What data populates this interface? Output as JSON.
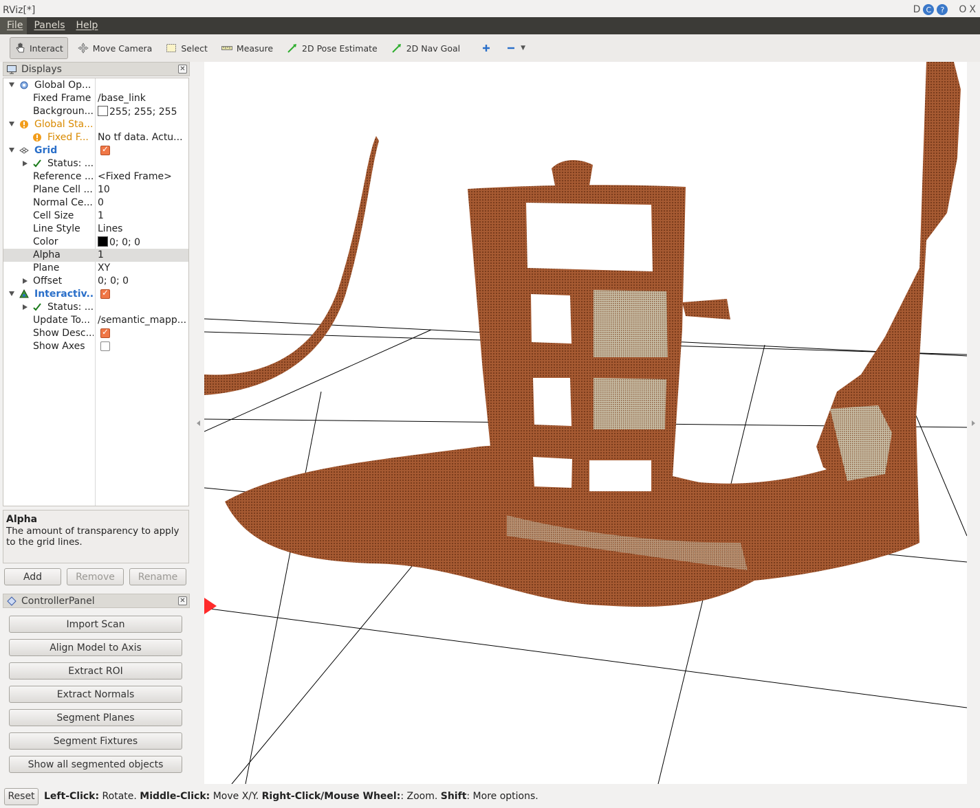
{
  "window": {
    "title": "RViz[*]",
    "controls": [
      "D",
      "C",
      "?",
      "O",
      "X"
    ]
  },
  "menu": [
    "File",
    "Panels",
    "Help"
  ],
  "toolbar": {
    "tools": [
      {
        "label": "Interact",
        "icon": "hand-pointer-icon",
        "active": true
      },
      {
        "label": "Move Camera",
        "icon": "move-arrows-icon"
      },
      {
        "label": "Select",
        "icon": "select-rect-icon"
      },
      {
        "label": "Measure",
        "icon": "ruler-icon"
      },
      {
        "label": "2D Pose Estimate",
        "icon": "green-arrow-icon"
      },
      {
        "label": "2D Nav Goal",
        "icon": "green-arrow-icon"
      }
    ],
    "add_icon": "plus-icon",
    "remove_icon": "minus-icon"
  },
  "displays": {
    "title": "Displays",
    "rows": [
      {
        "indent": 0,
        "expand": "down",
        "icon": "gear-icon",
        "label": "Global Op...",
        "value": ""
      },
      {
        "indent": 1,
        "label": "Fixed Frame",
        "value": "/base_link"
      },
      {
        "indent": 1,
        "label": "Backgroun...",
        "value": "255; 255; 255",
        "swatch": "#ffffff"
      },
      {
        "indent": 0,
        "expand": "down",
        "icon": "warning-icon",
        "label": "Global Sta...",
        "value": "",
        "style": "warn"
      },
      {
        "indent": 1,
        "icon": "warning-icon",
        "label": "Fixed F...",
        "value": "No tf data.  Actu...",
        "style": "warn"
      },
      {
        "indent": 0,
        "expand": "down",
        "icon": "grid-icon",
        "label": "Grid",
        "value": "",
        "style": "blue",
        "check": true
      },
      {
        "indent": 1,
        "expand": "right",
        "icon": "ok-check-icon",
        "label": "Status: ...",
        "value": ""
      },
      {
        "indent": 1,
        "label": "Reference ...",
        "value": "<Fixed Frame>"
      },
      {
        "indent": 1,
        "label": "Plane Cell ...",
        "value": "10"
      },
      {
        "indent": 1,
        "label": "Normal Ce...",
        "value": "0"
      },
      {
        "indent": 1,
        "label": "Cell Size",
        "value": "1"
      },
      {
        "indent": 1,
        "label": "Line Style",
        "value": "Lines"
      },
      {
        "indent": 1,
        "label": "Color",
        "value": "0; 0; 0",
        "swatch": "#000000"
      },
      {
        "indent": 1,
        "label": "Alpha",
        "value": "1",
        "selected": true
      },
      {
        "indent": 1,
        "label": "Plane",
        "value": "XY"
      },
      {
        "indent": 1,
        "expand": "right",
        "label": "Offset",
        "value": "0; 0; 0"
      },
      {
        "indent": 0,
        "expand": "down",
        "icon": "interactive-markers-icon",
        "label": "Interactiv...",
        "value": "",
        "style": "blue",
        "check": true
      },
      {
        "indent": 1,
        "expand": "right",
        "icon": "ok-check-icon",
        "label": "Status: ...",
        "value": ""
      },
      {
        "indent": 1,
        "label": "Update To...",
        "value": "/semantic_mapp..."
      },
      {
        "indent": 1,
        "label": "Show Desc...",
        "value": "",
        "check": true
      },
      {
        "indent": 1,
        "label": "Show Axes",
        "value": "",
        "check": false
      }
    ]
  },
  "help": {
    "title": "Alpha",
    "text": "The amount of transparency to apply to the grid lines."
  },
  "display_buttons": {
    "add": "Add",
    "remove": "Remove",
    "rename": "Rename"
  },
  "controller": {
    "title": "ControllerPanel",
    "buttons": [
      "Import Scan",
      "Align Model to Axis",
      "Extract ROI",
      "Extract Normals",
      "Segment Planes",
      "Segment Fixtures",
      "Show all segmented objects"
    ]
  },
  "status": {
    "reset": "Reset",
    "parts": [
      {
        "b": "Left-Click:",
        "t": " Rotate. "
      },
      {
        "b": "Middle-Click:",
        "t": " Move X/Y. "
      },
      {
        "b": "Right-Click/Mouse Wheel:",
        "t": ": Zoom. "
      },
      {
        "b": "Shift",
        "t": ": More options."
      }
    ]
  },
  "colors": {
    "point_cloud": "#a0522d",
    "point_cloud_dark": "#7a3a1a",
    "accent_blue": "#2a6fc9",
    "warn": "#d98a00"
  }
}
